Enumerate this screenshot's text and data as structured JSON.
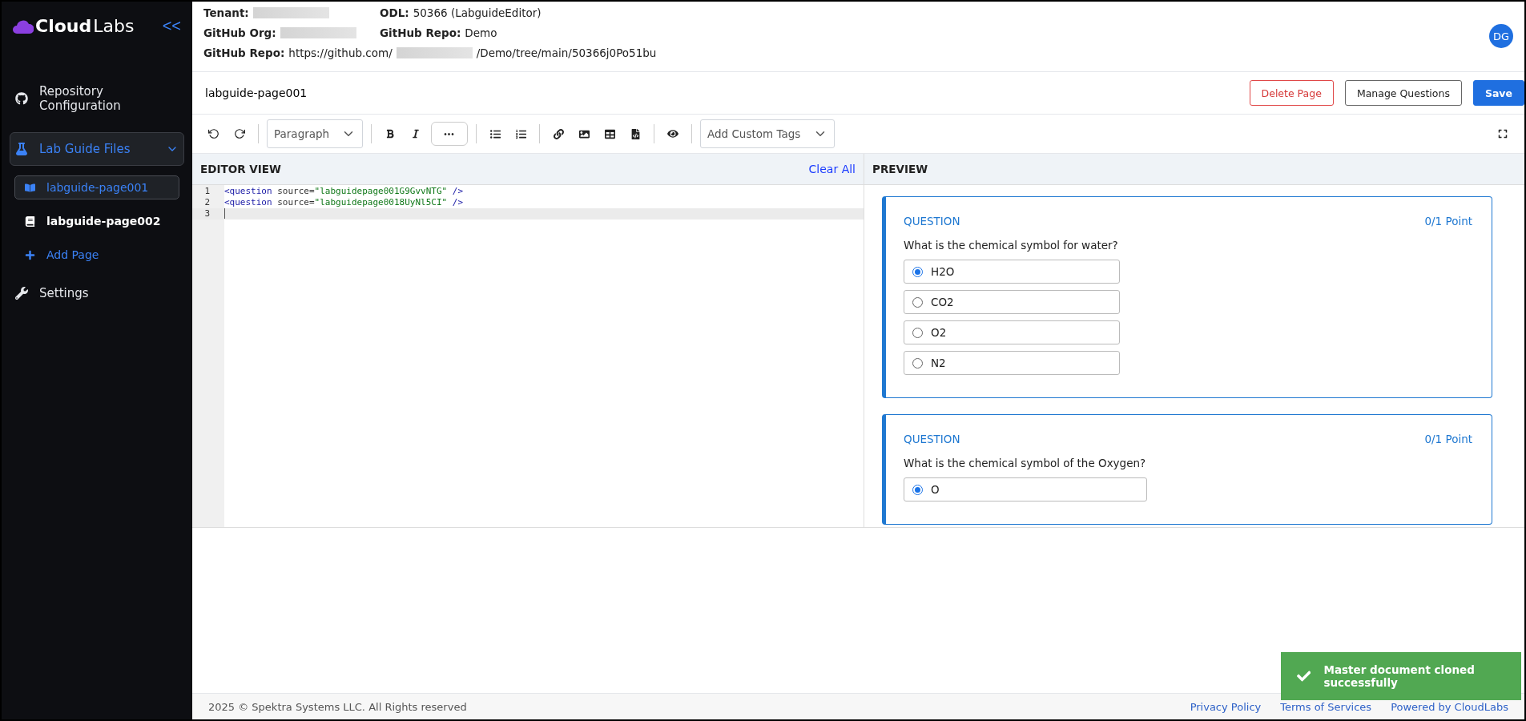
{
  "sidebar": {
    "logo": {
      "bold": "Cloud",
      "light": "Labs"
    },
    "collapse": "<<",
    "items": [
      {
        "kind": "link",
        "label": "Repository Configuration",
        "selected": false
      },
      {
        "kind": "group",
        "label": "Lab Guide Files",
        "expanded": true,
        "selected": true,
        "children": [
          {
            "kind": "page",
            "label": "labguide-page001",
            "selected": true
          },
          {
            "kind": "page",
            "label": "labguide-page002",
            "selected": false
          },
          {
            "kind": "add",
            "label": "Add Page",
            "selected": false
          }
        ]
      },
      {
        "kind": "link",
        "label": "Settings",
        "selected": false
      }
    ]
  },
  "header": {
    "fields": [
      {
        "label": "Tenant:",
        "parts": [
          {
            "kind": "redacted"
          }
        ]
      },
      {
        "label": "ODL:",
        "parts": [
          {
            "kind": "text",
            "text": "50366 (LabguideEditor)"
          }
        ]
      },
      {
        "label": "GitHub Org:",
        "parts": [
          {
            "kind": "redacted"
          }
        ]
      },
      {
        "label": "GitHub Repo:",
        "parts": [
          {
            "kind": "text",
            "text": "Demo"
          }
        ]
      },
      {
        "label": "GitHub Repo:",
        "parts": [
          {
            "kind": "text",
            "text": "https://github.com/"
          },
          {
            "kind": "redacted"
          },
          {
            "kind": "text",
            "text": "/Demo/tree/main/50366j0Po51bu"
          }
        ]
      }
    ],
    "avatar": "DG"
  },
  "page": {
    "title": "labguide-page001",
    "buttons": [
      {
        "kind": "danger",
        "label": "Delete Page"
      },
      {
        "kind": "outline",
        "label": "Manage Questions"
      },
      {
        "kind": "primary",
        "label": "Save"
      }
    ]
  },
  "toolbar": {
    "paragraph": "Paragraph",
    "custom_tags": "Add Custom Tags",
    "more": "•••"
  },
  "editor": {
    "title": "EDITOR VIEW",
    "clear": "Clear All",
    "lines": [
      {
        "number": "1",
        "tag": "<question",
        "attr": " source=",
        "value": "\"labguidepage001G9GvvNTG\"",
        "end": " />",
        "current": false
      },
      {
        "number": "2",
        "tag": "<question",
        "attr": " source=",
        "value": "\"labguidepage0018UyNl5CI\"",
        "end": " />",
        "current": false
      },
      {
        "number": "3",
        "current": true
      }
    ]
  },
  "preview": {
    "title": "PREVIEW",
    "questions": [
      {
        "label": "QUESTION",
        "points": "0/1 Point",
        "text": "What is the chemical symbol for water?",
        "options": [
          {
            "label": "H2O",
            "selected": true
          },
          {
            "label": "CO2",
            "selected": false
          },
          {
            "label": "O2",
            "selected": false
          },
          {
            "label": "N2",
            "selected": false
          }
        ]
      },
      {
        "label": "QUESTION",
        "points": "0/1 Point",
        "text": "What is the chemical symbol of the Oxygen?",
        "options": [
          {
            "label": "O",
            "selected": true
          }
        ]
      }
    ]
  },
  "footer": {
    "copyright": "2025 © Spektra Systems LLC. All Rights reserved",
    "links": [
      "Privacy Policy",
      "Terms of Services",
      "Powered by CloudLabs"
    ]
  },
  "toast": {
    "message": "Master document cloned successfully"
  }
}
